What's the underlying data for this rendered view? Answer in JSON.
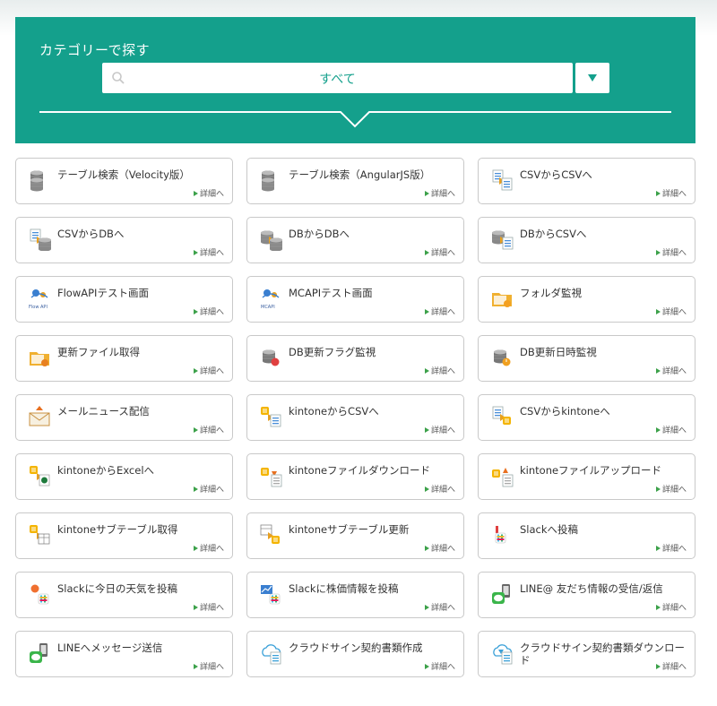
{
  "category": {
    "title": "カテゴリーで探す",
    "selected": "すべて",
    "toggle_icon": "triangle-down-icon"
  },
  "detail_label": "詳細へ",
  "cards": [
    {
      "label": "テーブル検索（Velocity版）",
      "icon": "database-search"
    },
    {
      "label": "テーブル検索（AngularJS版）",
      "icon": "database-search"
    },
    {
      "label": "CSVからCSVへ",
      "icon": "csv-to-csv"
    },
    {
      "label": "CSVからDBへ",
      "icon": "csv-to-db"
    },
    {
      "label": "DBからDBへ",
      "icon": "db-to-db"
    },
    {
      "label": "DBからCSVへ",
      "icon": "db-to-csv"
    },
    {
      "label": "FlowAPIテスト画面",
      "icon": "flow-api"
    },
    {
      "label": "MCAPIテスト画面",
      "icon": "mcapi"
    },
    {
      "label": "フォルダ監視",
      "icon": "folder-watch"
    },
    {
      "label": "更新ファイル取得",
      "icon": "folder-update"
    },
    {
      "label": "DB更新フラグ監視",
      "icon": "db-flag"
    },
    {
      "label": "DB更新日時監視",
      "icon": "db-time"
    },
    {
      "label": "メールニュース配信",
      "icon": "mail"
    },
    {
      "label": "kintoneからCSVへ",
      "icon": "kintone-to-csv"
    },
    {
      "label": "CSVからkintoneへ",
      "icon": "csv-to-kintone"
    },
    {
      "label": "kintoneからExcelへ",
      "icon": "kintone-to-excel"
    },
    {
      "label": "kintoneファイルダウンロード",
      "icon": "kintone-download"
    },
    {
      "label": "kintoneファイルアップロード",
      "icon": "kintone-upload"
    },
    {
      "label": "kintoneサブテーブル取得",
      "icon": "kintone-subtable"
    },
    {
      "label": "kintoneサブテーブル更新",
      "icon": "kintone-subtable-update"
    },
    {
      "label": "Slackへ投稿",
      "icon": "slack"
    },
    {
      "label": "Slackに今日の天気を投稿",
      "icon": "slack-weather"
    },
    {
      "label": "Slackに株価情報を投稿",
      "icon": "slack-stock"
    },
    {
      "label": "LINE@ 友だち情報の受信/返信",
      "icon": "line-friend"
    },
    {
      "label": "LINEへメッセージ送信",
      "icon": "line-message"
    },
    {
      "label": "クラウドサイン契約書類作成",
      "icon": "cloudsign-create"
    },
    {
      "label": "クラウドサイン契約書類ダウンロード",
      "icon": "cloudsign-download"
    }
  ]
}
